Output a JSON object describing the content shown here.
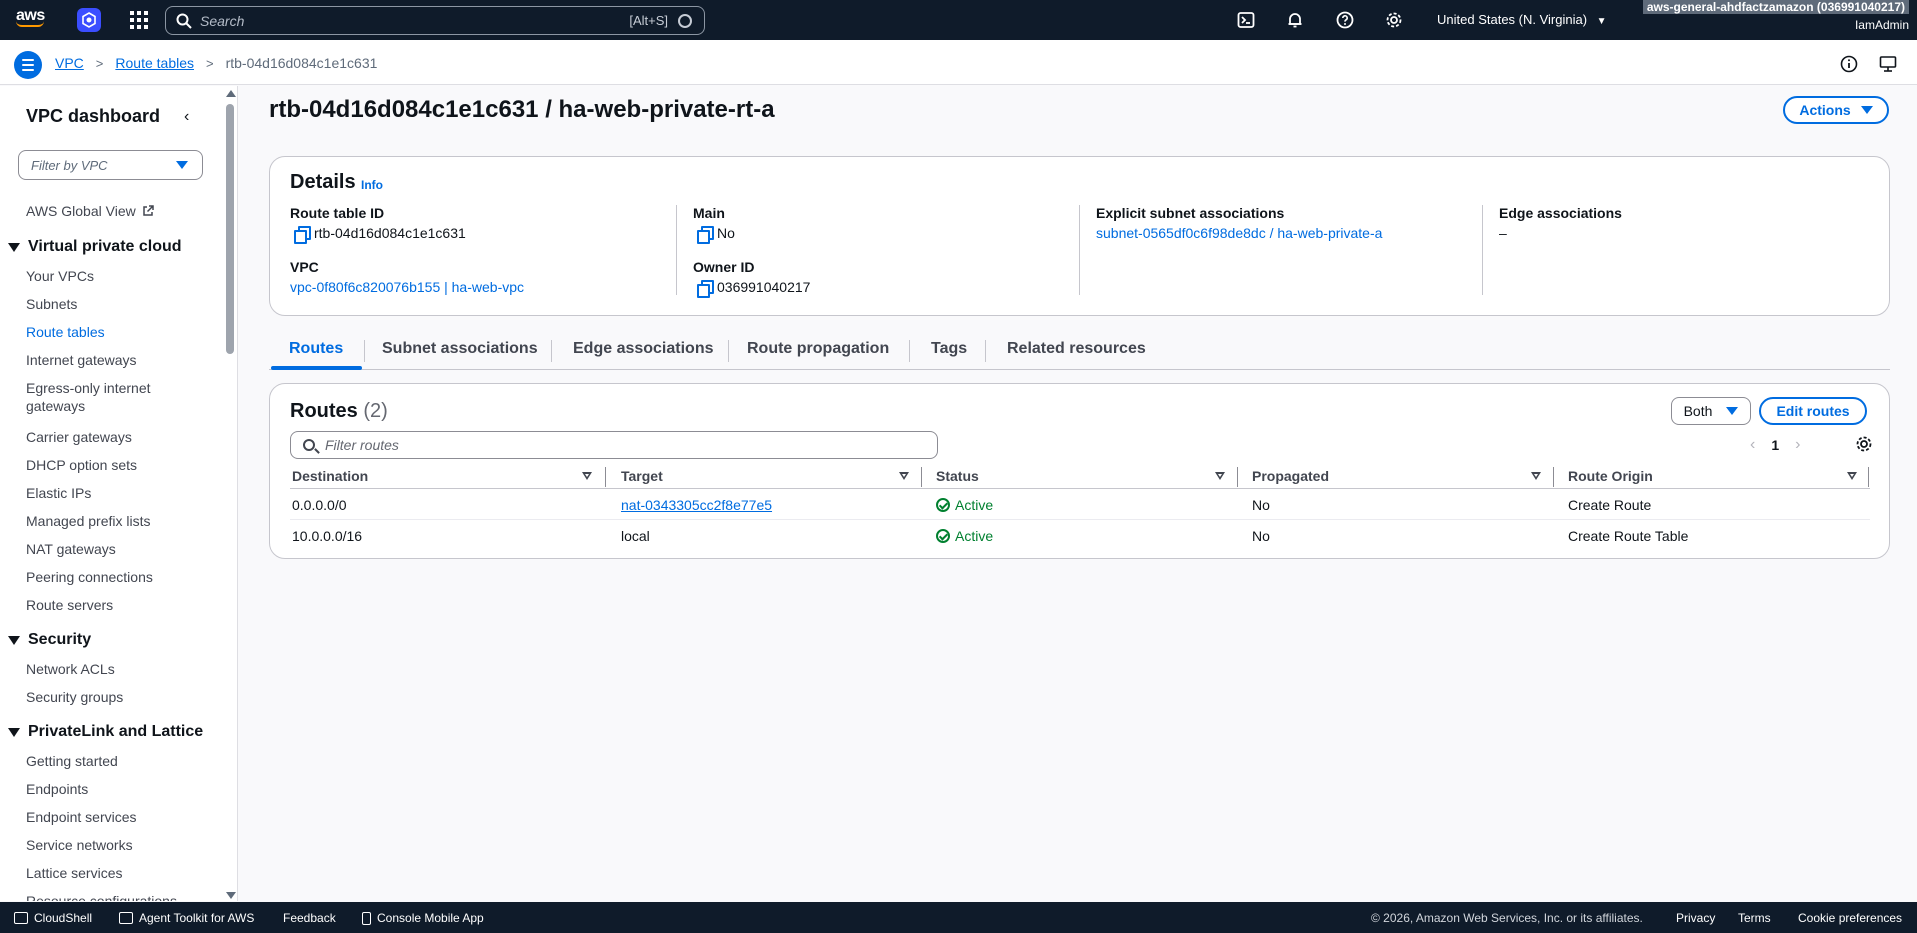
{
  "topnav": {
    "logo_text": "aws",
    "search_placeholder": "Search",
    "search_hint": "[Alt+S]",
    "region": "United States (N. Virginia)",
    "account": "aws-general-ahdfactzamazon (036991040217)",
    "user": "IamAdmin"
  },
  "breadcrumb": {
    "items": [
      "VPC",
      "Route tables"
    ],
    "current": "rtb-04d16d084c1e1c631"
  },
  "sidebar": {
    "title": "VPC dashboard",
    "filter_placeholder": "Filter by VPC",
    "global_view": "AWS Global View",
    "sections": [
      {
        "title": "Virtual private cloud"
      },
      {
        "title": "Security"
      },
      {
        "title": "PrivateLink and Lattice"
      }
    ],
    "vpc_items": [
      "Your VPCs",
      "Subnets",
      "Route tables",
      "Internet gateways",
      "Egress-only internet gateways",
      "Carrier gateways",
      "DHCP option sets",
      "Elastic IPs",
      "Managed prefix lists",
      "NAT gateways",
      "Peering connections",
      "Route servers"
    ],
    "security_items": [
      "Network ACLs",
      "Security groups"
    ],
    "privatelink_items": [
      "Getting started",
      "Endpoints",
      "Endpoint services",
      "Service networks",
      "Lattice services",
      "Resource configurations"
    ]
  },
  "page": {
    "title": "rtb-04d16d084c1e1c631 / ha-web-private-rt-a",
    "actions_label": "Actions"
  },
  "details": {
    "title": "Details",
    "info": "Info",
    "route_table_id_label": "Route table ID",
    "route_table_id": "rtb-04d16d084c1e1c631",
    "vpc_label": "VPC",
    "vpc": "vpc-0f80f6c820076b155 | ha-web-vpc",
    "main_label": "Main",
    "main": "No",
    "owner_label": "Owner ID",
    "owner": "036991040217",
    "explicit_label": "Explicit subnet associations",
    "explicit": "subnet-0565df0c6f98de8dc / ha-web-private-a",
    "edge_label": "Edge associations",
    "edge": "–"
  },
  "tabs": [
    "Routes",
    "Subnet associations",
    "Edge associations",
    "Route propagation",
    "Tags",
    "Related resources"
  ],
  "routes": {
    "title": "Routes",
    "count": "(2)",
    "both_label": "Both",
    "edit_label": "Edit routes",
    "filter_placeholder": "Filter routes",
    "page": "1",
    "columns": [
      "Destination",
      "Target",
      "Status",
      "Propagated",
      "Route Origin"
    ],
    "rows": [
      {
        "destination": "0.0.0.0/0",
        "target": "nat-0343305cc2f8e77e5",
        "status": "Active",
        "propagated": "No",
        "origin": "Create Route"
      },
      {
        "destination": "10.0.0.0/16",
        "target": "local",
        "status": "Active",
        "propagated": "No",
        "origin": "Create Route Table"
      }
    ]
  },
  "footer": {
    "cloudshell": "CloudShell",
    "agent": "Agent Toolkit for AWS",
    "feedback": "Feedback",
    "mobile": "Console Mobile App",
    "copyright": "© 2026, Amazon Web Services, Inc. or its affiliates.",
    "privacy": "Privacy",
    "terms": "Terms",
    "cookies": "Cookie preferences"
  },
  "colors": {
    "nav_bg": "#0f1b2a",
    "accent": "#006ce0",
    "success": "#00802f",
    "brand_orange": "#ff9900"
  }
}
